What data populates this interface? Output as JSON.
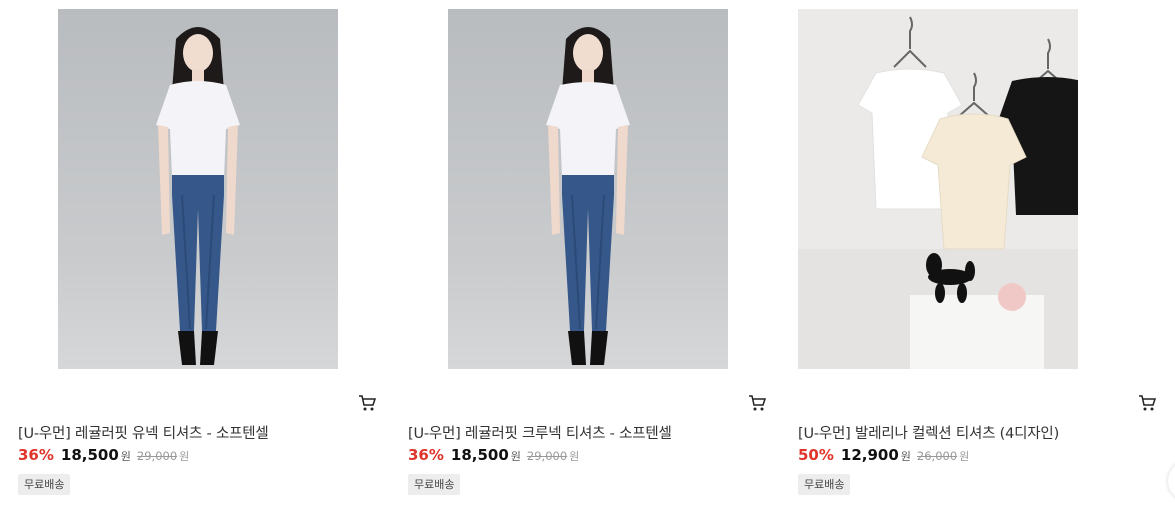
{
  "products": [
    {
      "image": "woman-white-tshirt-jeans-photo",
      "title": "[U-우먼] 레귤러핏 유넥 티셔츠 - 소프텐셀",
      "discount": "36%",
      "price": "18,500",
      "price_unit": "원",
      "original_price": "29,000",
      "original_unit": "원",
      "badge": "무료배송"
    },
    {
      "image": "woman-white-tshirt-jeans-photo",
      "title": "[U-우먼] 레귤러핏 크루넥 티셔츠 - 소프텐셀",
      "discount": "36%",
      "price": "18,500",
      "price_unit": "원",
      "original_price": "29,000",
      "original_unit": "원",
      "badge": "무료배송"
    },
    {
      "image": "hanging-tshirts-photo",
      "title": "[U-우먼] 발레리나 컬렉션 티셔츠 (4디자인)",
      "discount": "50%",
      "price": "12,900",
      "price_unit": "원",
      "original_price": "26,000",
      "original_unit": "원",
      "badge": "무료배송"
    }
  ],
  "icons": {
    "cart": "cart-icon"
  },
  "colors": {
    "discount": "#e0352b",
    "badge_bg": "#ededed"
  }
}
